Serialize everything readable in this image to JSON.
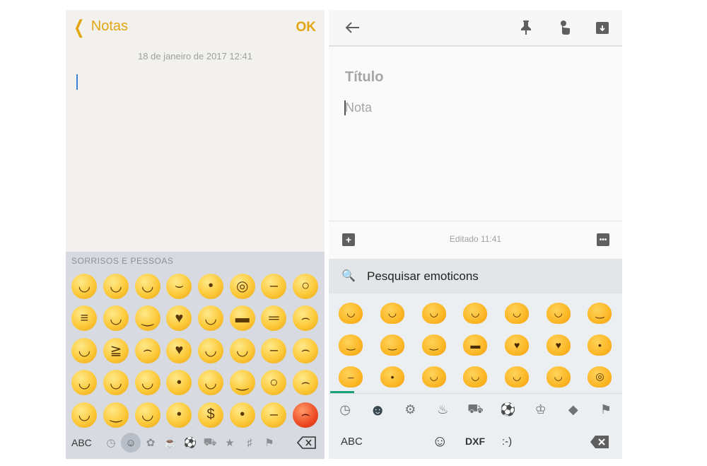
{
  "ios": {
    "back_label": "Notas",
    "done_label": "OK",
    "date": "18 de janeiro de 2017 12:41",
    "keyboard": {
      "section_label": "SORRISOS E PESSOAS",
      "abc_label": "ABC",
      "emojis": [
        "grinning",
        "grin",
        "smile",
        "relieved",
        "kissing-closed-eyes",
        "nerd",
        "neutral",
        "flushed",
        "grimacing",
        "sweat-smile",
        "slight-smile",
        "heart-eyes",
        "wink-tongue",
        "sunglasses",
        "expressionless",
        "disappointed",
        "laughing",
        "squinting",
        "upside-down",
        "kissing-heart",
        "squint-tongue",
        "hugging",
        "unamused",
        "worried",
        "joy",
        "innocent",
        "blush",
        "kissing",
        "tongue",
        "smirk",
        "eye-roll",
        "confused",
        "beaming",
        "winking",
        "yum",
        "kissing-smiling",
        "money-mouth",
        "no-mouth",
        "thinking",
        "angry-red"
      ],
      "categories": [
        "clock-icon",
        "smiley-icon",
        "animal-icon",
        "food-icon",
        "ball-icon",
        "car-icon",
        "bulb-icon",
        "symbols-icon",
        "flag-icon"
      ],
      "selected_category": "smiley-icon"
    },
    "colors": {
      "accent": "#e3a512",
      "cursor": "#3f7fd6"
    }
  },
  "android": {
    "title_placeholder": "Título",
    "note_placeholder": "Nota",
    "edited_label": "Editado 11:41",
    "search_label": "Pesquisar emoticons",
    "keyboard": {
      "abc_label": "ABC",
      "emoticon_label": ":-)",
      "dxf_label": "DXF",
      "emojis": [
        "grin",
        "laugh",
        "beaming",
        "smile",
        "smile-eyes",
        "happy",
        "wink",
        "slight-smile",
        "content",
        "smirk",
        "sunglasses",
        "heart-eyes",
        "kissing-heart",
        "kissing",
        "thinking-partial",
        "kissing-blush",
        "smile-partial",
        "blush",
        "laughing-hands",
        "innocent",
        "nerd"
      ],
      "categories": [
        "clock-icon",
        "smiley-icon",
        "gear-icon",
        "cake-icon",
        "car-icon",
        "ball-icon",
        "crown-icon",
        "diamond-icon",
        "flag-icon"
      ],
      "selected_category": "smiley-icon"
    },
    "colors": {
      "progress": "#1aa37a",
      "icon": "#5f5f5f"
    }
  }
}
